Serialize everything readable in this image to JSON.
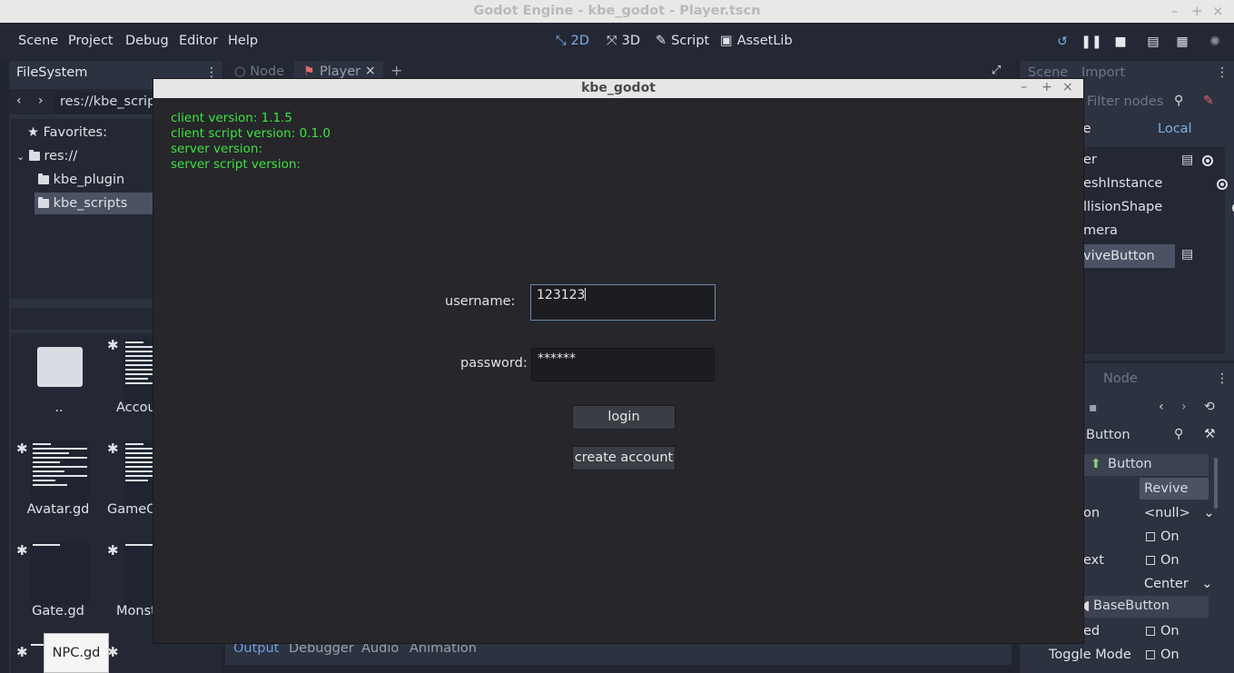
{
  "os_window": {
    "title": "Godot Engine - kbe_godot - Player.tscn"
  },
  "menu": [
    "Scene",
    "Project",
    "Debug",
    "Editor",
    "Help"
  ],
  "main_screens": [
    {
      "label": "2D",
      "icon": "2d-icon",
      "active": true
    },
    {
      "label": "3D",
      "icon": "3d-icon",
      "active": false
    },
    {
      "label": "Script",
      "icon": "script-icon",
      "active": false
    },
    {
      "label": "AssetLib",
      "icon": "assetlib-icon",
      "active": false
    }
  ],
  "filesystem": {
    "tab": "FileSystem",
    "path": "res://kbe_scripts",
    "favorites_label": "Favorites:",
    "tree": [
      {
        "label": "res://"
      },
      {
        "label": "kbe_plugin"
      },
      {
        "label": "kbe_scripts",
        "selected": true
      }
    ],
    "files": [
      "..",
      "Accou",
      "Avatar.gd",
      "GameO",
      "Gate.gd",
      "Monst",
      "NPC.gd"
    ]
  },
  "editor_tabs": {
    "node": "Node",
    "player": "Player"
  },
  "scene_dock": {
    "tabs": [
      "Scene",
      "Import"
    ],
    "filter_placeholder": "Filter nodes",
    "toggle_left": "te",
    "toggle_right": "Local",
    "nodes": [
      "er",
      "eshInstance",
      "llisionShape",
      "mera",
      "viveButton"
    ]
  },
  "inspector_dock": {
    "tab": "Node",
    "object": "Button",
    "category_button": "Button",
    "text_value": "Revive",
    "rows": [
      {
        "label": "on",
        "value": "<null>",
        "type": "dropdown"
      },
      {
        "label": "",
        "value": "On",
        "type": "check"
      },
      {
        "label": "ext",
        "value": "On",
        "type": "check"
      },
      {
        "label": "",
        "value": "Center",
        "type": "dropdown"
      }
    ],
    "category_base": "BaseButton",
    "rows2": [
      {
        "label": "ed",
        "value": "On"
      },
      {
        "label": "Toggle Mode",
        "value": "On"
      }
    ]
  },
  "bottom_tabs": [
    "Output",
    "Debugger",
    "Audio",
    "Animation"
  ],
  "dialog": {
    "title": "kbe_godot",
    "info": [
      "client version: 1.1.5",
      "client script version: 0.1.0",
      "server version:",
      "server script version:"
    ],
    "username_label": "username:",
    "username_value": "123123",
    "password_label": "password:",
    "password_value": "******",
    "login_label": "login",
    "create_label": "create account"
  },
  "colors": {
    "info_text": "#3ce53c",
    "accent": "#7faee6"
  }
}
